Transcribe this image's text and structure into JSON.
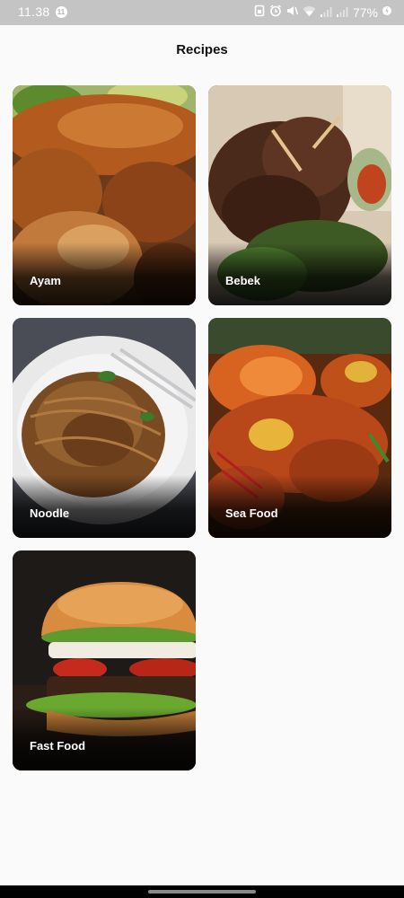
{
  "status_bar": {
    "time": "11.38",
    "notification_badge": "11",
    "battery": "77%",
    "icons": [
      "screenshot-icon",
      "alarm-icon",
      "mute-icon",
      "wifi-icon",
      "signal-icon",
      "signal-icon",
      "battery-charging-icon"
    ]
  },
  "header": {
    "title": "Recipes"
  },
  "categories": [
    {
      "label": "Ayam",
      "image": "roast-chicken-photo"
    },
    {
      "label": "Bebek",
      "image": "roast-duck-photo"
    },
    {
      "label": "Noodle",
      "image": "noodle-plate-photo"
    },
    {
      "label": "Sea Food",
      "image": "seafood-platter-photo"
    },
    {
      "label": "Fast Food",
      "image": "burger-photo"
    }
  ],
  "colors": {
    "background": "#fafafa",
    "status_bar": "#c4c4c4",
    "label_text": "#ffffff"
  }
}
